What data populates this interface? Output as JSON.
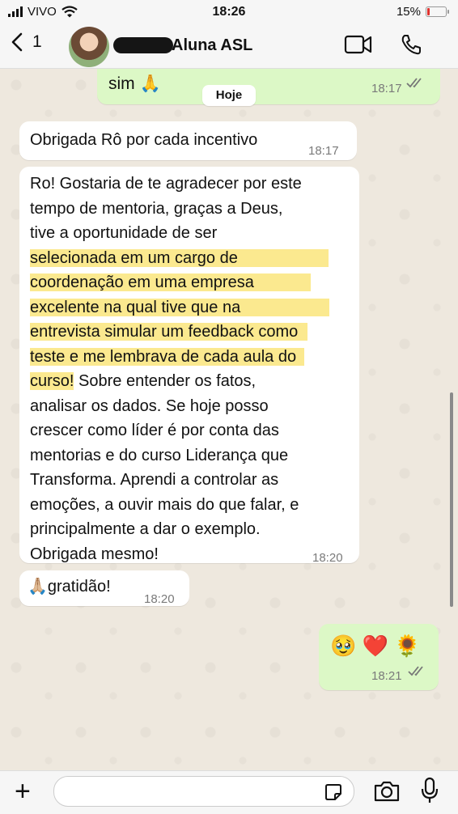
{
  "status_bar": {
    "carrier": "VIVO",
    "time": "18:26",
    "battery": "15%",
    "battery_level": 0.15
  },
  "header": {
    "back_count": "1",
    "contact_name": "Aluna ASL"
  },
  "chat": {
    "date_separator": "Hoje",
    "top_outgoing": {
      "text": "sim 🙏",
      "time": "18:17"
    },
    "msg1": {
      "text": "Obrigada Rô por cada incentivo",
      "time": "18:17"
    },
    "msg2": {
      "line1": "Ro! Gostaria de te agradecer por este",
      "line2": "tempo de mentoria, graças a Deus,",
      "line3": "tive a oportunidade de ser",
      "hl1": "selecionada em um cargo de",
      "hl2": "coordenação em uma empresa",
      "hl3": "excelente na qual tive que na",
      "hl4": "entrevista simular um feedback como",
      "hl5": "teste e me lembrava de cada aula do",
      "hl6": "curso!",
      "line4": " Sobre entender os fatos,",
      "line5": "analisar os dados. Se hoje posso",
      "line6": "crescer como líder é por conta das",
      "line7": "mentorias e do curso Liderança que",
      "line8": "Transforma. Aprendi a controlar as",
      "line9": "emoções, a ouvir mais do que falar, e",
      "line10": "principalmente a dar o exemplo.",
      "line11": "Obrigada mesmo!",
      "time": "18:20"
    },
    "msg3": {
      "text": "🙏🏼gratidão!",
      "time": "18:20"
    },
    "msg4": {
      "text": "🥹 ❤️ 🌻",
      "time": "18:21"
    }
  },
  "icons": [
    "signal-icon",
    "wifi-icon",
    "battery-icon",
    "back-chevron-icon",
    "video-call-icon",
    "phone-icon",
    "plus-icon",
    "sticker-icon",
    "camera-icon",
    "microphone-icon",
    "double-check-icon"
  ]
}
